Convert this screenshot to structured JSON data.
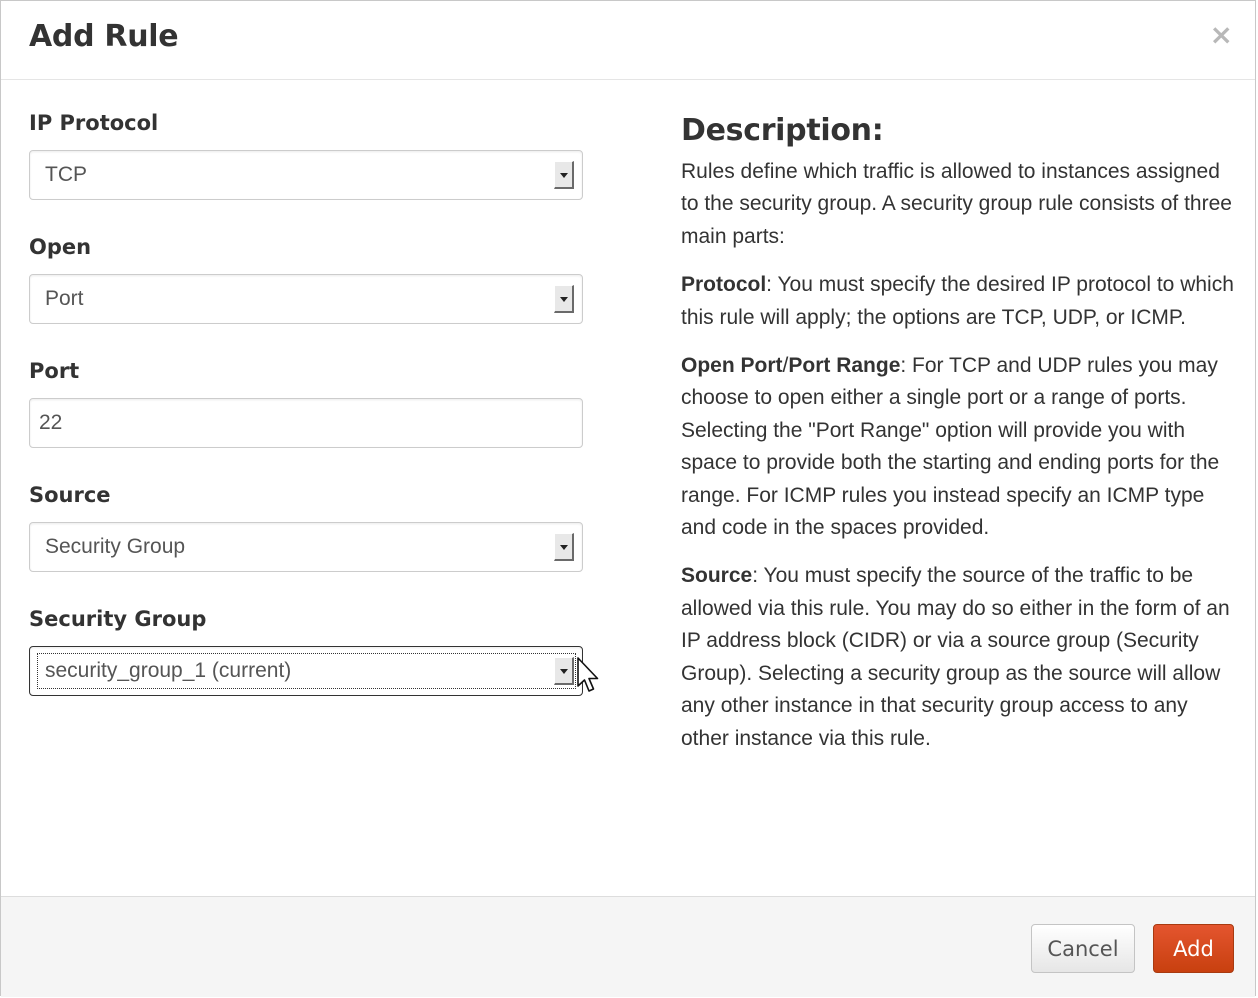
{
  "dialog": {
    "title": "Add Rule",
    "close_label": "×"
  },
  "form": {
    "ip_protocol": {
      "label": "IP Protocol",
      "value": "TCP"
    },
    "open": {
      "label": "Open",
      "value": "Port"
    },
    "port": {
      "label": "Port",
      "value": "22"
    },
    "source": {
      "label": "Source",
      "value": "Security Group"
    },
    "security_group": {
      "label": "Security Group",
      "value": "security_group_1 (current)"
    }
  },
  "description": {
    "title": "Description:",
    "intro": "Rules define which traffic is allowed to instances assigned to the security group. A security group rule consists of three main parts:",
    "protocol_term": "Protocol",
    "protocol_text": ": You must specify the desired IP protocol to which this rule will apply; the options are TCP, UDP, or ICMP.",
    "port_term": "Open Port",
    "port_sep": "/",
    "port_term2": "Port Range",
    "port_text": ": For TCP and UDP rules you may choose to open either a single port or a range of ports. Selecting the \"Port Range\" option will provide you with space to provide both the starting and ending ports for the range. For ICMP rules you instead specify an ICMP type and code in the spaces provided.",
    "source_term": "Source",
    "source_text": ": You must specify the source of the traffic to be allowed via this rule. You may do so either in the form of an IP address block (CIDR) or via a source group (Security Group). Selecting a security group as the source will allow any other instance in that security group access to any other instance via this rule."
  },
  "footer": {
    "cancel_label": "Cancel",
    "add_label": "Add",
    "add_color": "#d6491b"
  },
  "icons": {
    "close": "close-icon",
    "select_arrow": "chevron-down-icon",
    "cursor": "mouse-pointer-icon"
  }
}
